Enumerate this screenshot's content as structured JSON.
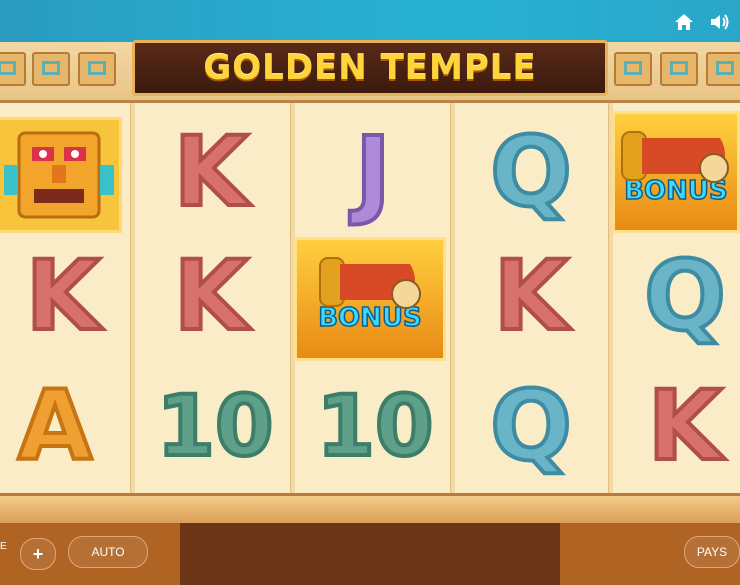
{
  "game": {
    "title": "GOLDEN TEMPLE"
  },
  "reels": {
    "bonus_label": "BONUS",
    "columns": [
      [
        "wild",
        "K",
        "A"
      ],
      [
        "K",
        "K",
        "10"
      ],
      [
        "J",
        "bonus",
        "10"
      ],
      [
        "Q",
        "K",
        "Q"
      ],
      [
        "bonus",
        "Q",
        "K"
      ]
    ]
  },
  "controls": {
    "edge_label": "E",
    "plus_label": "+",
    "auto_label": "AUTO",
    "pays_label": "PAYS"
  },
  "icons": {
    "home": "home-icon",
    "sound": "speaker-icon"
  },
  "colors": {
    "title_gold": "#ffd43a",
    "reel_bg": "#fbecc8",
    "bottom_bar": "#b06424"
  }
}
